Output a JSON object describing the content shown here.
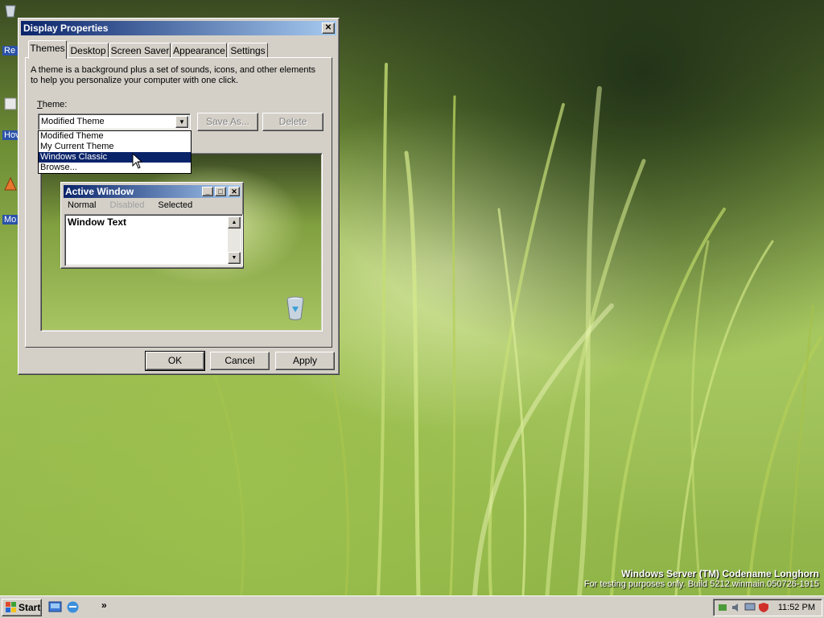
{
  "dialog": {
    "title": "Display Properties",
    "tabs": [
      "Themes",
      "Desktop",
      "Screen Saver",
      "Appearance",
      "Settings"
    ],
    "active_tab": "Themes",
    "description": "A theme is a background plus a set of sounds, icons, and other elements to help you personalize your computer with one click.",
    "theme_label": "Theme:",
    "theme_selected": "Modified Theme",
    "theme_options": [
      "Modified Theme",
      "My Current Theme",
      "Windows Classic",
      "Browse..."
    ],
    "highlighted_option": "Windows Classic",
    "save_as_label": "Save As...",
    "delete_label": "Delete",
    "ok_label": "OK",
    "cancel_label": "Cancel",
    "apply_label": "Apply",
    "preview": {
      "window_title": "Active Window",
      "menu": [
        "Normal",
        "Disabled",
        "Selected"
      ],
      "window_text": "Window Text"
    }
  },
  "desktop": {
    "icon_labels": [
      "Re",
      "Hov",
      "Mo"
    ],
    "watermark_line1": "Windows Server (TM) Codename Longhorn",
    "watermark_line2": "For testing purposes only. Build 5212.winmain.050726-1915"
  },
  "taskbar": {
    "start_label": "Start",
    "chevron": "»",
    "clock": "11:52 PM"
  },
  "colors": {
    "title_active_start": "#0a246a",
    "title_active_end": "#a6caf0",
    "face": "#d4d0c8",
    "highlight": "#0a246a"
  },
  "icons": [
    "close-icon",
    "minimize-icon",
    "maximize-icon",
    "dropdown-arrow-icon",
    "recycle-bin-icon",
    "windows-logo-icon",
    "ie-icon",
    "show-desktop-icon",
    "network-icon",
    "volume-icon",
    "security-shield-icon"
  ]
}
